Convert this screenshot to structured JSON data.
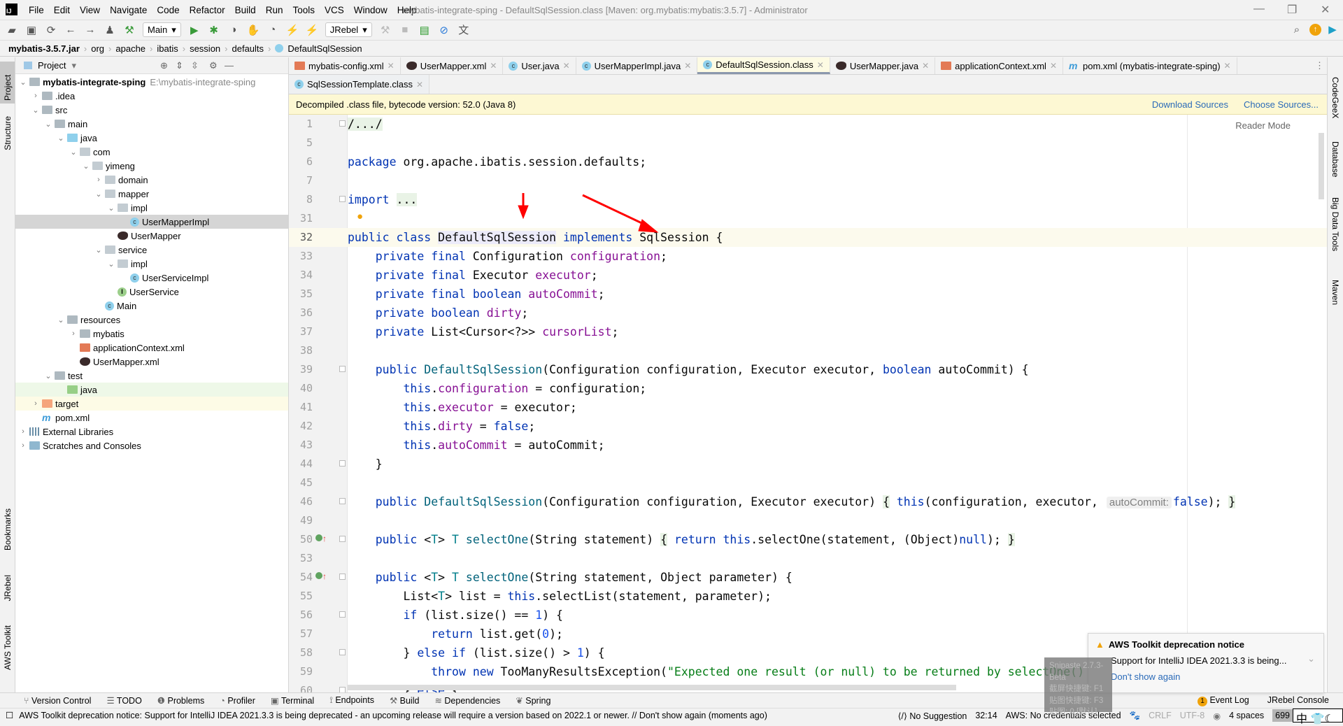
{
  "titlebar": {
    "menu": [
      "File",
      "Edit",
      "View",
      "Navigate",
      "Code",
      "Refactor",
      "Build",
      "Run",
      "Tools",
      "VCS",
      "Window",
      "Help"
    ],
    "title": "mybatis-integrate-sping - DefaultSqlSession.class [Maven: org.mybatis:mybatis:3.5.7] - Administrator",
    "logo": "IJ"
  },
  "toolbar": {
    "run_config": "Main",
    "jrebel": "JRebel"
  },
  "breadcrumb": [
    "mybatis-3.5.7.jar",
    "org",
    "apache",
    "ibatis",
    "session",
    "defaults",
    "DefaultSqlSession"
  ],
  "left_stripe": [
    "Project",
    "Structure",
    "Bookmarks",
    "JRebel",
    "AWS Toolkit"
  ],
  "right_stripe": [
    "CodeGeeX",
    "Database",
    "Big Data Tools",
    "Maven"
  ],
  "project": {
    "header": "Project",
    "tree": [
      {
        "label": "mybatis-integrate-sping",
        "path": "E:\\mybatis-integrate-sping",
        "depth": 0,
        "chev": "down",
        "icon": "folder",
        "bold": true
      },
      {
        "label": ".idea",
        "depth": 1,
        "chev": "right",
        "icon": "folder"
      },
      {
        "label": "src",
        "depth": 1,
        "chev": "down",
        "icon": "folder"
      },
      {
        "label": "main",
        "depth": 2,
        "chev": "down",
        "icon": "folder"
      },
      {
        "label": "java",
        "depth": 3,
        "chev": "down",
        "icon": "src"
      },
      {
        "label": "com",
        "depth": 4,
        "chev": "down",
        "icon": "pkg"
      },
      {
        "label": "yimeng",
        "depth": 5,
        "chev": "down",
        "icon": "pkg"
      },
      {
        "label": "domain",
        "depth": 6,
        "chev": "right",
        "icon": "pkg"
      },
      {
        "label": "mapper",
        "depth": 6,
        "chev": "down",
        "icon": "pkg"
      },
      {
        "label": "impl",
        "depth": 7,
        "chev": "down",
        "icon": "pkg"
      },
      {
        "label": "UserMapperImpl",
        "depth": 8,
        "icon": "cls",
        "state": "selected"
      },
      {
        "label": "UserMapper",
        "depth": 7,
        "icon": "bird"
      },
      {
        "label": "service",
        "depth": 6,
        "chev": "down",
        "icon": "pkg"
      },
      {
        "label": "impl",
        "depth": 7,
        "chev": "down",
        "icon": "pkg"
      },
      {
        "label": "UserServiceImpl",
        "depth": 8,
        "icon": "cls"
      },
      {
        "label": "UserService",
        "depth": 7,
        "icon": "intf"
      },
      {
        "label": "Main",
        "depth": 6,
        "icon": "cls"
      },
      {
        "label": "resources",
        "depth": 3,
        "chev": "down",
        "icon": "folder"
      },
      {
        "label": "mybatis",
        "depth": 4,
        "chev": "right",
        "icon": "folder"
      },
      {
        "label": "applicationContext.xml",
        "depth": 4,
        "icon": "xml"
      },
      {
        "label": "UserMapper.xml",
        "depth": 4,
        "icon": "bird"
      },
      {
        "label": "test",
        "depth": 2,
        "chev": "down",
        "icon": "folder"
      },
      {
        "label": "java",
        "depth": 3,
        "icon": "green",
        "state": "test"
      },
      {
        "label": "target",
        "depth": 1,
        "chev": "right",
        "icon": "orange",
        "state": "excluded"
      },
      {
        "label": "pom.xml",
        "depth": 1,
        "icon": "mvn"
      },
      {
        "label": "External Libraries",
        "depth": 0,
        "chev": "right",
        "icon": "lib"
      },
      {
        "label": "Scratches and Consoles",
        "depth": 0,
        "chev": "right",
        "icon": "scr"
      }
    ]
  },
  "tabs_row1": [
    {
      "label": "mybatis-config.xml",
      "icon": "xml"
    },
    {
      "label": "UserMapper.xml",
      "icon": "bird"
    },
    {
      "label": "User.java",
      "icon": "cls"
    },
    {
      "label": "UserMapperImpl.java",
      "icon": "cls"
    },
    {
      "label": "DefaultSqlSession.class",
      "icon": "cls",
      "active": true
    },
    {
      "label": "UserMapper.java",
      "icon": "bird"
    },
    {
      "label": "applicationContext.xml",
      "icon": "xml"
    },
    {
      "label": "pom.xml (mybatis-integrate-sping)",
      "icon": "mvn"
    }
  ],
  "tabs_row2": [
    {
      "label": "SqlSessionTemplate.class",
      "icon": "cls"
    }
  ],
  "notice": {
    "text": "Decompiled .class file, bytecode version: 52.0 (Java 8)",
    "download": "Download Sources",
    "choose": "Choose Sources..."
  },
  "editor": {
    "reader_mode": "Reader Mode",
    "current_line": "32",
    "lines": [
      {
        "n": "1",
        "fold": true,
        "t": [
          [
            "fold",
            "/.../"
          ]
        ]
      },
      {
        "n": "5",
        "t": []
      },
      {
        "n": "6",
        "t": [
          [
            "k",
            "package"
          ],
          [
            "p",
            " org.apache.ibatis.session.defaults;"
          ]
        ]
      },
      {
        "n": "7",
        "t": []
      },
      {
        "n": "8",
        "fold": true,
        "t": [
          [
            "k",
            "import"
          ],
          [
            "p",
            " "
          ],
          [
            "fold",
            "..."
          ]
        ]
      },
      {
        "n": "31",
        "bulb": true,
        "t": []
      },
      {
        "n": "32",
        "t": [
          [
            "k",
            "public class "
          ],
          [
            "sel",
            "DefaultSqlSession"
          ],
          [
            "p",
            " "
          ],
          [
            "k",
            "implements"
          ],
          [
            "p",
            " SqlSession {"
          ]
        ]
      },
      {
        "n": "33",
        "t": [
          [
            "p",
            "    "
          ],
          [
            "k",
            "private final "
          ],
          [
            "p",
            "Configuration "
          ],
          [
            "f",
            "configuration"
          ],
          [
            "p",
            ";"
          ]
        ]
      },
      {
        "n": "34",
        "t": [
          [
            "p",
            "    "
          ],
          [
            "k",
            "private final "
          ],
          [
            "p",
            "Executor "
          ],
          [
            "f",
            "executor"
          ],
          [
            "p",
            ";"
          ]
        ]
      },
      {
        "n": "35",
        "t": [
          [
            "p",
            "    "
          ],
          [
            "k",
            "private final boolean "
          ],
          [
            "f",
            "autoCommit"
          ],
          [
            "p",
            ";"
          ]
        ]
      },
      {
        "n": "36",
        "t": [
          [
            "p",
            "    "
          ],
          [
            "k",
            "private boolean "
          ],
          [
            "f",
            "dirty"
          ],
          [
            "p",
            ";"
          ]
        ]
      },
      {
        "n": "37",
        "t": [
          [
            "p",
            "    "
          ],
          [
            "k",
            "private "
          ],
          [
            "p",
            "List<Cursor<?>> "
          ],
          [
            "f",
            "cursorList"
          ],
          [
            "p",
            ";"
          ]
        ]
      },
      {
        "n": "38",
        "t": []
      },
      {
        "n": "39",
        "fold": true,
        "t": [
          [
            "p",
            "    "
          ],
          [
            "k",
            "public "
          ],
          [
            "m",
            "DefaultSqlSession"
          ],
          [
            "p",
            "(Configuration configuration, Executor executor, "
          ],
          [
            "k",
            "boolean"
          ],
          [
            "p",
            " autoCommit) {"
          ]
        ]
      },
      {
        "n": "40",
        "t": [
          [
            "p",
            "        "
          ],
          [
            "k",
            "this"
          ],
          [
            "p",
            "."
          ],
          [
            "f",
            "configuration"
          ],
          [
            "p",
            " = configuration;"
          ]
        ]
      },
      {
        "n": "41",
        "t": [
          [
            "p",
            "        "
          ],
          [
            "k",
            "this"
          ],
          [
            "p",
            "."
          ],
          [
            "f",
            "executor"
          ],
          [
            "p",
            " = executor;"
          ]
        ]
      },
      {
        "n": "42",
        "t": [
          [
            "p",
            "        "
          ],
          [
            "k",
            "this"
          ],
          [
            "p",
            "."
          ],
          [
            "f",
            "dirty"
          ],
          [
            "p",
            " = "
          ],
          [
            "k",
            "false"
          ],
          [
            "p",
            ";"
          ]
        ]
      },
      {
        "n": "43",
        "t": [
          [
            "p",
            "        "
          ],
          [
            "k",
            "this"
          ],
          [
            "p",
            "."
          ],
          [
            "f",
            "autoCommit"
          ],
          [
            "p",
            " = autoCommit;"
          ]
        ]
      },
      {
        "n": "44",
        "fold": true,
        "t": [
          [
            "p",
            "    }"
          ]
        ]
      },
      {
        "n": "45",
        "t": []
      },
      {
        "n": "46",
        "fold": true,
        "t": [
          [
            "p",
            "    "
          ],
          [
            "k",
            "public "
          ],
          [
            "m",
            "DefaultSqlSession"
          ],
          [
            "p",
            "(Configuration configuration, Executor executor) "
          ],
          [
            "fold",
            "{"
          ],
          [
            "p",
            " "
          ],
          [
            "k",
            "this"
          ],
          [
            "p",
            "(configuration, executor, "
          ],
          [
            "h",
            "autoCommit:"
          ],
          [
            "k",
            "false"
          ],
          [
            "p",
            "); "
          ],
          [
            "fold",
            "}"
          ]
        ]
      },
      {
        "n": "49",
        "t": []
      },
      {
        "n": "50",
        "impl": true,
        "fold": true,
        "t": [
          [
            "p",
            "    "
          ],
          [
            "k",
            "public "
          ],
          [
            "p",
            "<"
          ],
          [
            "t",
            "T"
          ],
          [
            "p",
            "> "
          ],
          [
            "t",
            "T"
          ],
          [
            "p",
            " "
          ],
          [
            "m",
            "selectOne"
          ],
          [
            "p",
            "(String statement) "
          ],
          [
            "fold",
            "{"
          ],
          [
            "p",
            " "
          ],
          [
            "k",
            "return this"
          ],
          [
            "p",
            ".selectOne(statement, (Object)"
          ],
          [
            "k",
            "null"
          ],
          [
            "p",
            "); "
          ],
          [
            "fold",
            "}"
          ]
        ]
      },
      {
        "n": "53",
        "t": []
      },
      {
        "n": "54",
        "impl": true,
        "fold": true,
        "t": [
          [
            "p",
            "    "
          ],
          [
            "k",
            "public "
          ],
          [
            "p",
            "<"
          ],
          [
            "t",
            "T"
          ],
          [
            "p",
            "> "
          ],
          [
            "t",
            "T"
          ],
          [
            "p",
            " "
          ],
          [
            "m",
            "selectOne"
          ],
          [
            "p",
            "(String statement, Object parameter) {"
          ]
        ]
      },
      {
        "n": "55",
        "t": [
          [
            "p",
            "        List<"
          ],
          [
            "t",
            "T"
          ],
          [
            "p",
            "> list = "
          ],
          [
            "k",
            "this"
          ],
          [
            "p",
            ".selectList(statement, parameter);"
          ]
        ]
      },
      {
        "n": "56",
        "fold": true,
        "t": [
          [
            "p",
            "        "
          ],
          [
            "k",
            "if"
          ],
          [
            "p",
            " (list.size() == "
          ],
          [
            "n",
            "1"
          ],
          [
            "p",
            ") {"
          ]
        ]
      },
      {
        "n": "57",
        "t": [
          [
            "p",
            "            "
          ],
          [
            "k",
            "return"
          ],
          [
            "p",
            " list.get("
          ],
          [
            "n",
            "0"
          ],
          [
            "p",
            ");"
          ]
        ]
      },
      {
        "n": "58",
        "fold": true,
        "t": [
          [
            "p",
            "        } "
          ],
          [
            "k",
            "else if"
          ],
          [
            "p",
            " (list.size() > "
          ],
          [
            "n",
            "1"
          ],
          [
            "p",
            ") {"
          ]
        ]
      },
      {
        "n": "59",
        "t": [
          [
            "p",
            "            "
          ],
          [
            "k",
            "throw new"
          ],
          [
            "p",
            " TooManyResultsException("
          ],
          [
            "s",
            "\"Expected one result (or null) to be returned by selectOne()"
          ]
        ]
      },
      {
        "n": "60",
        "fold": true,
        "t": [
          [
            "p",
            "        } "
          ],
          [
            "k",
            "else"
          ],
          [
            "p",
            " {"
          ]
        ]
      }
    ]
  },
  "bottom_tools": [
    "Version Control",
    "TODO",
    "Problems",
    "Profiler",
    "Terminal",
    "Endpoints",
    "Build",
    "Dependencies",
    "Spring"
  ],
  "bottom_right": {
    "event_log": "Event Log",
    "event_count": "1",
    "jrebel_console": "JRebel Console"
  },
  "status": {
    "message": "AWS Toolkit deprecation notice: Support for IntelliJ IDEA 2021.3.3 is being deprecated - an upcoming release will require a version based on 2022.1 or newer. // Don't show again (moments ago)",
    "suggestion": "No Suggestion",
    "position": "32:14",
    "aws": "AWS: No credentials selected",
    "line_sep": "CRLF",
    "encoding": "UTF-8",
    "indent": "4 spaces",
    "memory": "699",
    "ime": "中"
  },
  "popup": {
    "title": "AWS Toolkit deprecation notice",
    "body": "Support for IntelliJ IDEA 2021.3.3 is being...",
    "action": "Don't show again"
  },
  "snipaste": [
    "Snipaste 2.7.3-Beta",
    "截屏快捷键: F1",
    "贴图快捷键: F3",
    "贴图: 0 [默认]"
  ],
  "colors": {
    "keyword": "#0033b3",
    "field": "#871094",
    "string": "#067d17",
    "number": "#1750eb",
    "method": "#00627a",
    "annotation_arrow": "#ff0000"
  }
}
